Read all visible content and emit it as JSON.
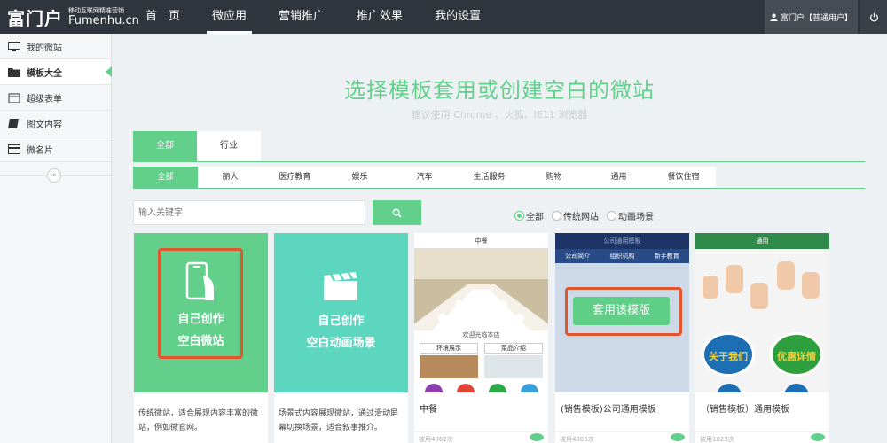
{
  "brand": {
    "title": "富门户",
    "tagline": "移动互联网精准营销",
    "domain": "Fumenhu.cn"
  },
  "nav": [
    "首　页",
    "微应用",
    "营销推广",
    "推广效果",
    "我的设置"
  ],
  "user": {
    "label": "富门户【普通用户】"
  },
  "sidebar": [
    "我的微站",
    "模板大全",
    "超级表单",
    "图文内容",
    "微名片"
  ],
  "collapse": "«",
  "hero": {
    "title": "选择模板套用或创建空白的微站",
    "subtitle": "建议使用 Chrome 、火狐、IE11 浏览器"
  },
  "tabs1": [
    "全部",
    "行业"
  ],
  "tabs2": [
    "全部",
    "丽人",
    "医疗教育",
    "娱乐",
    "汽车",
    "生活服务",
    "购物",
    "通用",
    "餐饮住宿"
  ],
  "search": {
    "placeholder": "输入关键字"
  },
  "radios": [
    "全部",
    "传统网站",
    "动画场景"
  ],
  "cards": {
    "create_site": {
      "thumb": [
        "自己创作",
        "空白微站"
      ],
      "desc": "传统微站，适合展现内容丰富的微站，例如微官网。"
    },
    "create_anim": {
      "thumb": [
        "自己创作",
        "空白动画场景"
      ],
      "desc": "场景式内容展现微站，通过滑动屏幕切换场景，适合叙事推介。"
    },
    "restaurant": {
      "ribbon": "中餐",
      "name": "中餐",
      "banner": "欢迎光临本店",
      "links": [
        "环境展示",
        "菜品介绍"
      ],
      "views": "被用4062次"
    },
    "company": {
      "ribbon": "公司通用模板",
      "menu": [
        "公司简介",
        "组织机构",
        "新手教育"
      ],
      "button": "套用该模版",
      "name": "(销售模板)公司通用模板",
      "views": "被用4005次"
    },
    "general": {
      "ribbon": "通用",
      "buttons": [
        "关于我们",
        "优惠详情"
      ],
      "name": "（销售模板）通用模板",
      "views": "被用1023次"
    }
  }
}
